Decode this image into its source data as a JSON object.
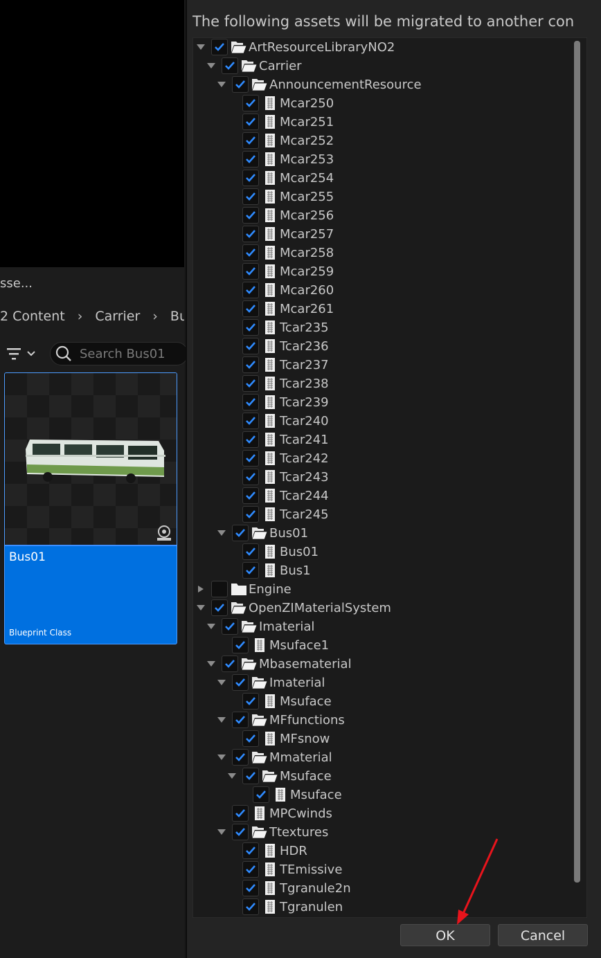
{
  "background": {
    "asset_header": "sse...",
    "breadcrumb": [
      "2 Content",
      "Carrier",
      "Bu"
    ],
    "search_placeholder": "Search Bus01",
    "asset": {
      "name": "Bus01",
      "type": "Blueprint Class"
    }
  },
  "dialog": {
    "message": "The following assets will be migrated to another con",
    "ok_label": "OK",
    "cancel_label": "Cancel",
    "tree": [
      {
        "label": "ArtResourceLibraryNO2",
        "kind": "folder",
        "depth": 0,
        "expanded": true,
        "checked": true
      },
      {
        "label": "Carrier",
        "kind": "folder",
        "depth": 1,
        "expanded": true,
        "checked": true
      },
      {
        "label": "AnnouncementResource",
        "kind": "folder",
        "depth": 2,
        "expanded": true,
        "checked": true
      },
      {
        "label": "Mcar250",
        "kind": "file",
        "depth": 3,
        "checked": true
      },
      {
        "label": "Mcar251",
        "kind": "file",
        "depth": 3,
        "checked": true
      },
      {
        "label": "Mcar252",
        "kind": "file",
        "depth": 3,
        "checked": true
      },
      {
        "label": "Mcar253",
        "kind": "file",
        "depth": 3,
        "checked": true
      },
      {
        "label": "Mcar254",
        "kind": "file",
        "depth": 3,
        "checked": true
      },
      {
        "label": "Mcar255",
        "kind": "file",
        "depth": 3,
        "checked": true
      },
      {
        "label": "Mcar256",
        "kind": "file",
        "depth": 3,
        "checked": true
      },
      {
        "label": "Mcar257",
        "kind": "file",
        "depth": 3,
        "checked": true
      },
      {
        "label": "Mcar258",
        "kind": "file",
        "depth": 3,
        "checked": true
      },
      {
        "label": "Mcar259",
        "kind": "file",
        "depth": 3,
        "checked": true
      },
      {
        "label": "Mcar260",
        "kind": "file",
        "depth": 3,
        "checked": true
      },
      {
        "label": "Mcar261",
        "kind": "file",
        "depth": 3,
        "checked": true
      },
      {
        "label": "Tcar235",
        "kind": "file",
        "depth": 3,
        "checked": true
      },
      {
        "label": "Tcar236",
        "kind": "file",
        "depth": 3,
        "checked": true
      },
      {
        "label": "Tcar237",
        "kind": "file",
        "depth": 3,
        "checked": true
      },
      {
        "label": "Tcar238",
        "kind": "file",
        "depth": 3,
        "checked": true
      },
      {
        "label": "Tcar239",
        "kind": "file",
        "depth": 3,
        "checked": true
      },
      {
        "label": "Tcar240",
        "kind": "file",
        "depth": 3,
        "checked": true
      },
      {
        "label": "Tcar241",
        "kind": "file",
        "depth": 3,
        "checked": true
      },
      {
        "label": "Tcar242",
        "kind": "file",
        "depth": 3,
        "checked": true
      },
      {
        "label": "Tcar243",
        "kind": "file",
        "depth": 3,
        "checked": true
      },
      {
        "label": "Tcar244",
        "kind": "file",
        "depth": 3,
        "checked": true
      },
      {
        "label": "Tcar245",
        "kind": "file",
        "depth": 3,
        "checked": true
      },
      {
        "label": "Bus01",
        "kind": "folder",
        "depth": 2,
        "expanded": true,
        "checked": true
      },
      {
        "label": "Bus01",
        "kind": "file",
        "depth": 3,
        "checked": true
      },
      {
        "label": "Bus1",
        "kind": "file",
        "depth": 3,
        "checked": true
      },
      {
        "label": "Engine",
        "kind": "folder",
        "depth": 0,
        "expanded": false,
        "checked": false
      },
      {
        "label": "OpenZIMaterialSystem",
        "kind": "folder",
        "depth": 0,
        "expanded": true,
        "checked": true
      },
      {
        "label": "Imaterial",
        "kind": "folder",
        "depth": 1,
        "expanded": true,
        "checked": true
      },
      {
        "label": "Msuface1",
        "kind": "file",
        "depth": 2,
        "checked": true
      },
      {
        "label": "Mbasematerial",
        "kind": "folder",
        "depth": 1,
        "expanded": true,
        "checked": true
      },
      {
        "label": "Imaterial",
        "kind": "folder",
        "depth": 2,
        "expanded": true,
        "checked": true
      },
      {
        "label": "Msuface",
        "kind": "file",
        "depth": 3,
        "checked": true
      },
      {
        "label": "MFfunctions",
        "kind": "folder",
        "depth": 2,
        "expanded": true,
        "checked": true
      },
      {
        "label": "MFsnow",
        "kind": "file",
        "depth": 3,
        "checked": true
      },
      {
        "label": "Mmaterial",
        "kind": "folder",
        "depth": 2,
        "expanded": true,
        "checked": true
      },
      {
        "label": "Msuface",
        "kind": "folder",
        "depth": 3,
        "expanded": true,
        "checked": true
      },
      {
        "label": "Msuface",
        "kind": "file",
        "depth": 4,
        "checked": true
      },
      {
        "label": "MPCwinds",
        "kind": "file",
        "depth": 2,
        "checked": true
      },
      {
        "label": "Ttextures",
        "kind": "folder",
        "depth": 2,
        "expanded": true,
        "checked": true
      },
      {
        "label": "HDR",
        "kind": "file",
        "depth": 3,
        "checked": true
      },
      {
        "label": "TEmissive",
        "kind": "file",
        "depth": 3,
        "checked": true
      },
      {
        "label": "Tgranule2n",
        "kind": "file",
        "depth": 3,
        "checked": true
      },
      {
        "label": "Tgranulen",
        "kind": "file",
        "depth": 3,
        "checked": true
      }
    ]
  },
  "icons": {
    "folder": "folder-open-icon",
    "folder_closed": "folder-icon",
    "file": "file-icon",
    "check": "checkmark-icon",
    "expand": "chevron-down-icon",
    "collapse": "chevron-right-icon"
  },
  "colors": {
    "accent": "#0070e0",
    "check": "#2f8bff",
    "annotation": "#e8141c"
  }
}
